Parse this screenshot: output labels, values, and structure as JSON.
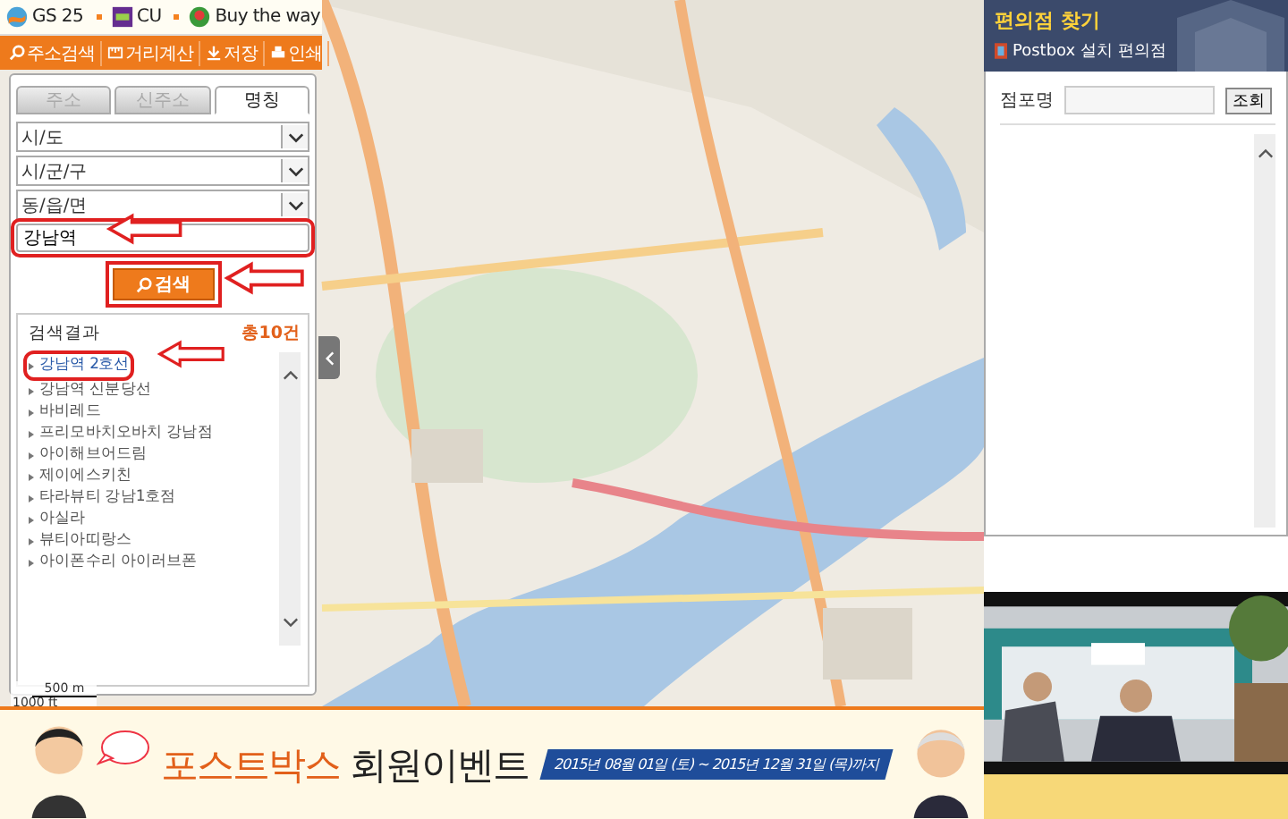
{
  "top_bar": {
    "brands": [
      {
        "kind": "gs",
        "label": "GS 25"
      },
      {
        "kind": "cu",
        "label": "CU"
      },
      {
        "kind": "btw",
        "label": "Buy the way"
      }
    ]
  },
  "toolbar": {
    "buttons": [
      {
        "kind": "search",
        "label": "주소검색"
      },
      {
        "kind": "ruler",
        "label": "거리계산"
      },
      {
        "kind": "save",
        "label": "저장"
      },
      {
        "kind": "print",
        "label": "인쇄"
      }
    ]
  },
  "search_panel": {
    "tabs": [
      {
        "label": "주소",
        "selected": false
      },
      {
        "label": "신주소",
        "selected": false
      },
      {
        "label": "명칭",
        "selected": true
      }
    ],
    "selects": [
      {
        "value": "시/도"
      },
      {
        "value": "시/군/구"
      },
      {
        "value": "동/읍/면"
      }
    ],
    "query": {
      "value": "강남역"
    },
    "search_button": "검색",
    "results": {
      "title": "검색결과",
      "count": "총10건",
      "items": [
        {
          "label": "강남역 2호선",
          "selected": true
        },
        {
          "label": "강남역 신분당선",
          "selected": false
        },
        {
          "label": "바비레드",
          "selected": false
        },
        {
          "label": "프리모바치오바치 강남점",
          "selected": false
        },
        {
          "label": "아이해브어드림",
          "selected": false
        },
        {
          "label": "제이에스키친",
          "selected": false
        },
        {
          "label": "타라뷰티 강남1호점",
          "selected": false
        },
        {
          "label": "아실라",
          "selected": false
        },
        {
          "label": "뷰티아띠랑스",
          "selected": false
        },
        {
          "label": "아이폰수리 아이러브폰",
          "selected": false
        }
      ]
    }
  },
  "scale": {
    "metric": "500 m",
    "imperial": "1000 ft"
  },
  "right_panel": {
    "title": "편의점 찾기",
    "subtitle": "Postbox 설치 편의점",
    "field_label": "점포명",
    "lookup_button": "조회"
  },
  "banner": {
    "title": "포스트박스",
    "title_rest": "회원이벤트",
    "dates": "2015년 08월 01일 (토) ~ 2015년 12월 31일 (목)까지"
  }
}
